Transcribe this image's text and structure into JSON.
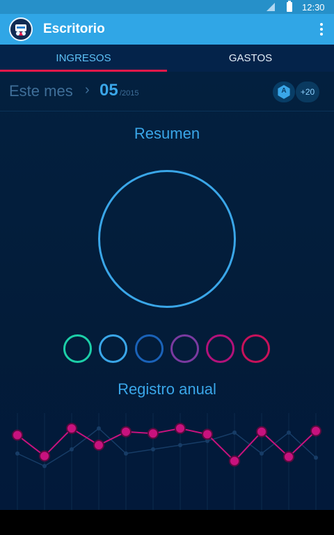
{
  "status_bar": {
    "time": "12:30",
    "icons": [
      "signal-icon",
      "battery-icon"
    ]
  },
  "app_bar": {
    "title": "Escritorio",
    "logo": "app-logo",
    "menu_icon": "more-vert-icon"
  },
  "tabs": [
    {
      "label": "INGRESOS",
      "active": true
    },
    {
      "label": "GASTOS",
      "active": false
    }
  ],
  "period": {
    "label": "Este mes",
    "chevron": "›",
    "month": "05",
    "year": "/2015"
  },
  "badges": {
    "achievement_letter": "A",
    "extra_count": "+20"
  },
  "sections": {
    "summary_title": "Resumen",
    "annual_title": "Registro anual"
  },
  "colors": {
    "accent": "#3aa6e8",
    "highlight": "#e8184a",
    "category_rings": [
      "#1ccfa8",
      "#3aa6e8",
      "#1a62b8",
      "#7a3aa0",
      "#b2127a",
      "#c8125a"
    ]
  },
  "chart_data": {
    "type": "line",
    "series": [
      {
        "values": [
          8.2,
          5.7,
          9.0,
          7.0,
          8.6,
          8.4,
          9.0,
          8.3,
          5.1,
          8.6,
          5.6,
          8.7
        ],
        "color": "#c8127e"
      },
      {
        "values": [
          6.0,
          4.5,
          6.5,
          9.0,
          6.0,
          6.5,
          7.0,
          7.5,
          8.5,
          6.0,
          8.5,
          5.5
        ],
        "color": "#173c66"
      }
    ],
    "ylim": [
      0,
      10
    ]
  }
}
